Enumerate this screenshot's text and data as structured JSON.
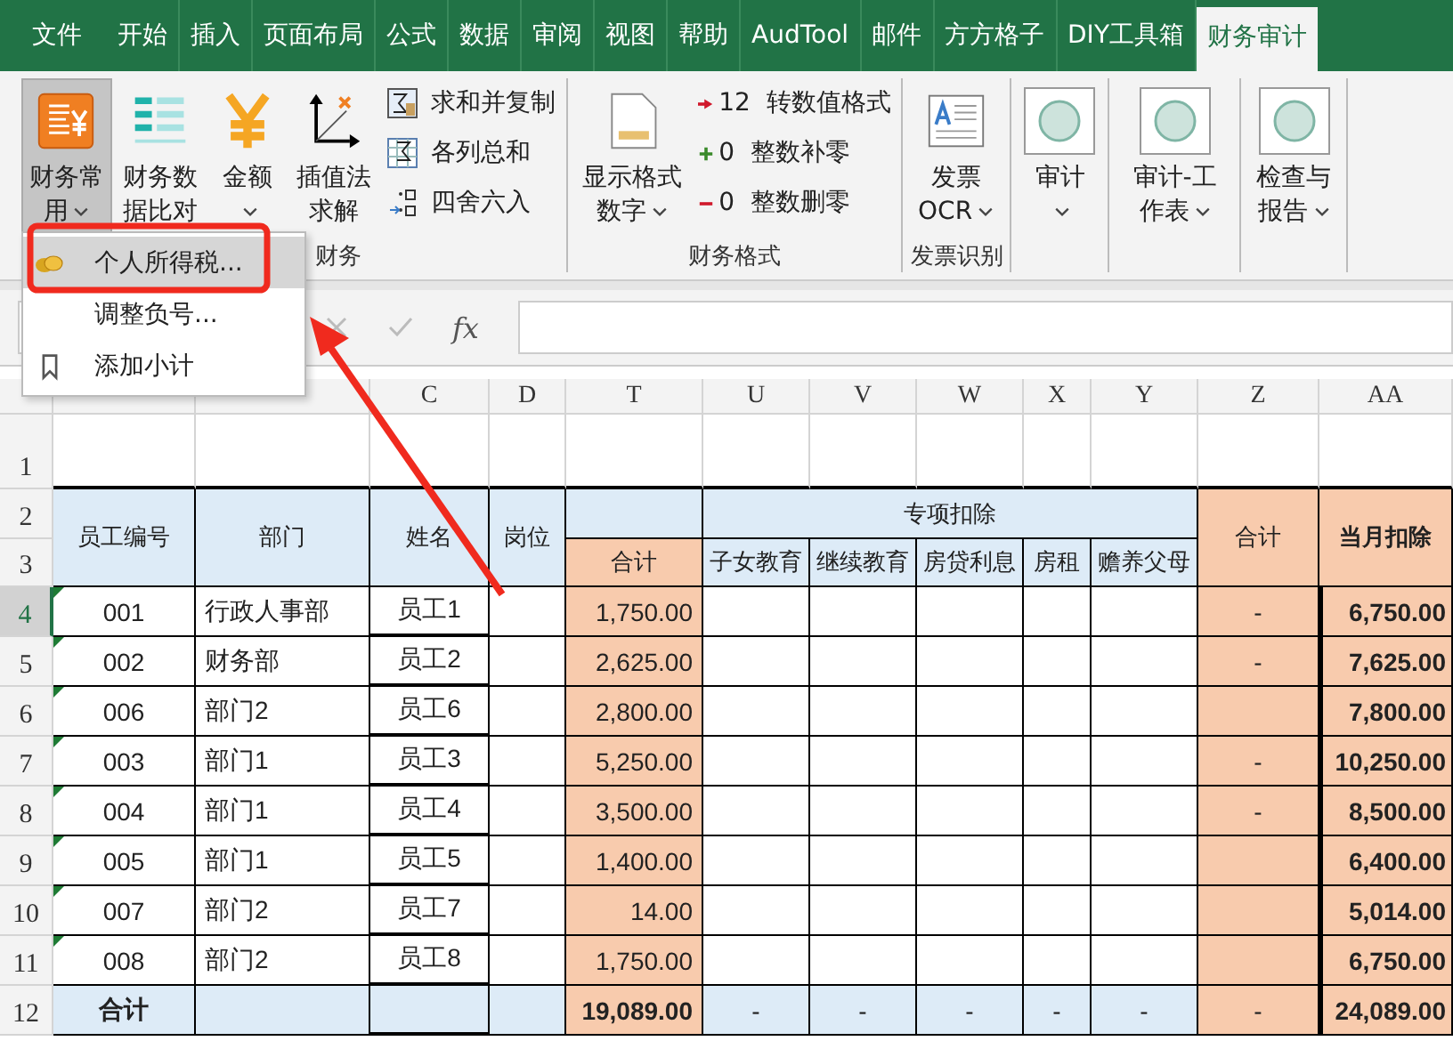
{
  "tabs": [
    {
      "label": "文件",
      "selected": false
    },
    {
      "label": "开始",
      "selected": false
    },
    {
      "label": "插入",
      "selected": false
    },
    {
      "label": "页面布局",
      "selected": false
    },
    {
      "label": "公式",
      "selected": false
    },
    {
      "label": "数据",
      "selected": false
    },
    {
      "label": "审阅",
      "selected": false
    },
    {
      "label": "视图",
      "selected": false
    },
    {
      "label": "帮助",
      "selected": false
    },
    {
      "label": "AudTool",
      "selected": false
    },
    {
      "label": "邮件",
      "selected": false
    },
    {
      "label": "方方格子",
      "selected": false
    },
    {
      "label": "DIY工具箱",
      "selected": false
    },
    {
      "label": "财务审计",
      "selected": true
    }
  ],
  "ribbon": {
    "groups": [
      {
        "label": "财务",
        "items": [
          {
            "kind": "large",
            "label": "财务常用",
            "dropdown": true,
            "pressed": true
          },
          {
            "kind": "large",
            "label": "财务数据比对",
            "dropdown": false,
            "pressed": false
          },
          {
            "kind": "large",
            "label": "金额",
            "dropdown": true,
            "pressed": false
          },
          {
            "kind": "large",
            "label": "插值法求解",
            "dropdown": false,
            "pressed": false
          },
          {
            "kind": "stack",
            "items": [
              {
                "label": "求和并复制"
              },
              {
                "label": "各列总和"
              },
              {
                "label": "四舍六入"
              }
            ]
          }
        ]
      },
      {
        "label": "财务格式",
        "items": [
          {
            "kind": "large",
            "label": "显示格式数字",
            "dropdown": true,
            "pressed": false
          },
          {
            "kind": "stack",
            "items": [
              {
                "label": "转数值格式",
                "digits": "12"
              },
              {
                "label": "整数补零",
                "digits": "0"
              },
              {
                "label": "整数删零",
                "digits": "0"
              }
            ]
          }
        ]
      },
      {
        "label": "发票识别",
        "items": [
          {
            "kind": "large",
            "label": "发票OCR",
            "dropdown": true,
            "pressed": false
          }
        ]
      },
      {
        "items": [
          {
            "kind": "large",
            "label": "审计",
            "dropdown": true,
            "pressed": false
          }
        ]
      },
      {
        "items": [
          {
            "kind": "large",
            "label": "审计-工作表",
            "dropdown": true,
            "pressed": false
          }
        ]
      },
      {
        "items": [
          {
            "kind": "large",
            "label": "检查与报告",
            "dropdown": true,
            "pressed": false
          }
        ]
      }
    ]
  },
  "menu": {
    "items": [
      {
        "label": "个人所得税...",
        "selected": true
      },
      {
        "label": "调整负号...",
        "selected": false
      },
      {
        "label": "添加小计",
        "selected": false
      }
    ]
  },
  "formula_bar": {
    "function_label": "fx"
  },
  "table": {
    "columns": [
      "C",
      "D",
      "T",
      "U",
      "V",
      "W",
      "X",
      "Y",
      "Z",
      "AA"
    ],
    "header_row_numbers": [
      "1",
      "2",
      "3"
    ],
    "header": {
      "fixed": [
        "员工编号",
        "部门",
        "姓名",
        "岗位"
      ],
      "subtotal": "合计",
      "group": {
        "title": "专项扣除",
        "items": [
          "子女教育",
          "继续教育",
          "房贷利息",
          "房租",
          "赡养父母"
        ]
      },
      "group_total": "合计",
      "monthly": "当月扣除"
    },
    "rows": [
      {
        "row_number": "4",
        "selected": true,
        "flagged": true,
        "id": "001",
        "dept": "行政人事部",
        "name": "员工1",
        "total": "1,750.00",
        "special_total": "-",
        "monthly": "6,750.00"
      },
      {
        "row_number": "5",
        "selected": false,
        "flagged": true,
        "id": "002",
        "dept": "财务部",
        "name": "员工2",
        "total": "2,625.00",
        "special_total": "-",
        "monthly": "7,625.00"
      },
      {
        "row_number": "6",
        "selected": false,
        "flagged": true,
        "id": "006",
        "dept": "部门2",
        "name": "员工6",
        "total": "2,800.00",
        "monthly": "7,800.00"
      },
      {
        "row_number": "7",
        "selected": false,
        "flagged": true,
        "id": "003",
        "dept": "部门1",
        "name": "员工3",
        "total": "5,250.00",
        "special_total": "-",
        "monthly": "10,250.00"
      },
      {
        "row_number": "8",
        "selected": false,
        "flagged": true,
        "id": "004",
        "dept": "部门1",
        "name": "员工4",
        "total": "3,500.00",
        "special_total": "-",
        "monthly": "8,500.00"
      },
      {
        "row_number": "9",
        "selected": false,
        "flagged": true,
        "id": "005",
        "dept": "部门1",
        "name": "员工5",
        "total": "1,400.00",
        "monthly": "6,400.00"
      },
      {
        "row_number": "10",
        "selected": false,
        "flagged": true,
        "id": "007",
        "dept": "部门2",
        "name": "员工7",
        "total": "14.00",
        "monthly": "5,014.00"
      },
      {
        "row_number": "11",
        "selected": false,
        "flagged": true,
        "id": "008",
        "dept": "部门2",
        "name": "员工8",
        "total": "1,750.00",
        "monthly": "6,750.00"
      },
      {
        "row_number": "12",
        "selected": false,
        "flagged": false,
        "kind": "total",
        "id": "合计",
        "total": "19,089.00",
        "special": [
          "-",
          "-",
          "-",
          "-",
          "-"
        ],
        "special_total": "-",
        "monthly": "24,089.00"
      }
    ]
  }
}
